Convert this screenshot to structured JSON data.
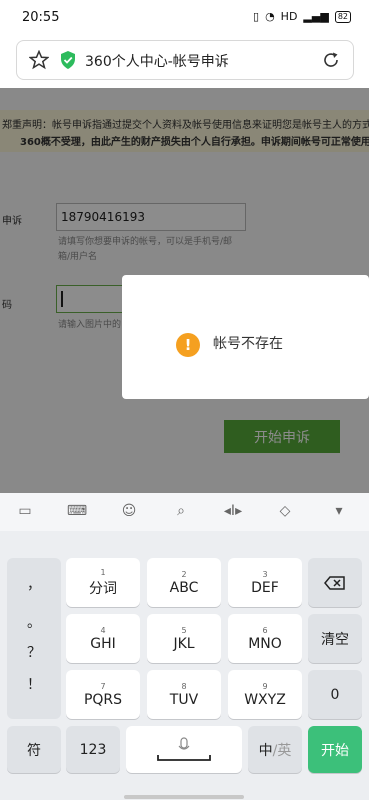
{
  "status_bar": {
    "time": "20:55",
    "network": "HD",
    "battery": "82"
  },
  "browser": {
    "url_title": "360个人中心-帐号申诉"
  },
  "page": {
    "notice_line1": "郑重声明：帐号申诉指通过提交个人资料及帐号使用信息来证明您是帐号主人的方式,",
    "notice_line2": "360概不受理，由此产生的财产损失由个人自行承担。申诉期间帐号可正常使用,",
    "account_label": "申诉",
    "account_value": "18790416193",
    "account_hint_line1": "请填写你想要申诉的帐号，可以是手机号/邮",
    "account_hint_line2": "箱/用户名",
    "captcha_label": "码",
    "captcha_hint": "请输入图片中的",
    "start_button": "开始申诉"
  },
  "dialog": {
    "message": "帐号不存在",
    "icon": "warning-icon"
  },
  "keyboard": {
    "toolbar_icons": [
      "briefcase-icon",
      "keyboard-icon",
      "emoji-icon",
      "search-icon",
      "cursor-move-icon",
      "clear-format-icon",
      "collapse-icon"
    ],
    "punctuation": [
      "，",
      "。",
      "？",
      "！"
    ],
    "rows": [
      [
        {
          "num": "1",
          "label": "分词"
        },
        {
          "num": "2",
          "label": "ABC"
        },
        {
          "num": "3",
          "label": "DEF"
        }
      ],
      [
        {
          "num": "4",
          "label": "GHI"
        },
        {
          "num": "5",
          "label": "JKL"
        },
        {
          "num": "6",
          "label": "MNO"
        }
      ],
      [
        {
          "num": "7",
          "label": "PQRS"
        },
        {
          "num": "8",
          "label": "TUV"
        },
        {
          "num": "9",
          "label": "WXYZ"
        }
      ]
    ],
    "clear_key": "清空",
    "zero_key": "0",
    "symbol_key": "符",
    "num_key": "123",
    "lang_key_cn": "中",
    "lang_key_en": "/英",
    "go_key": "开始"
  },
  "colors": {
    "accent_green": "#56a93a",
    "go_green": "#3cc07a",
    "warning_orange": "#f5a020"
  }
}
